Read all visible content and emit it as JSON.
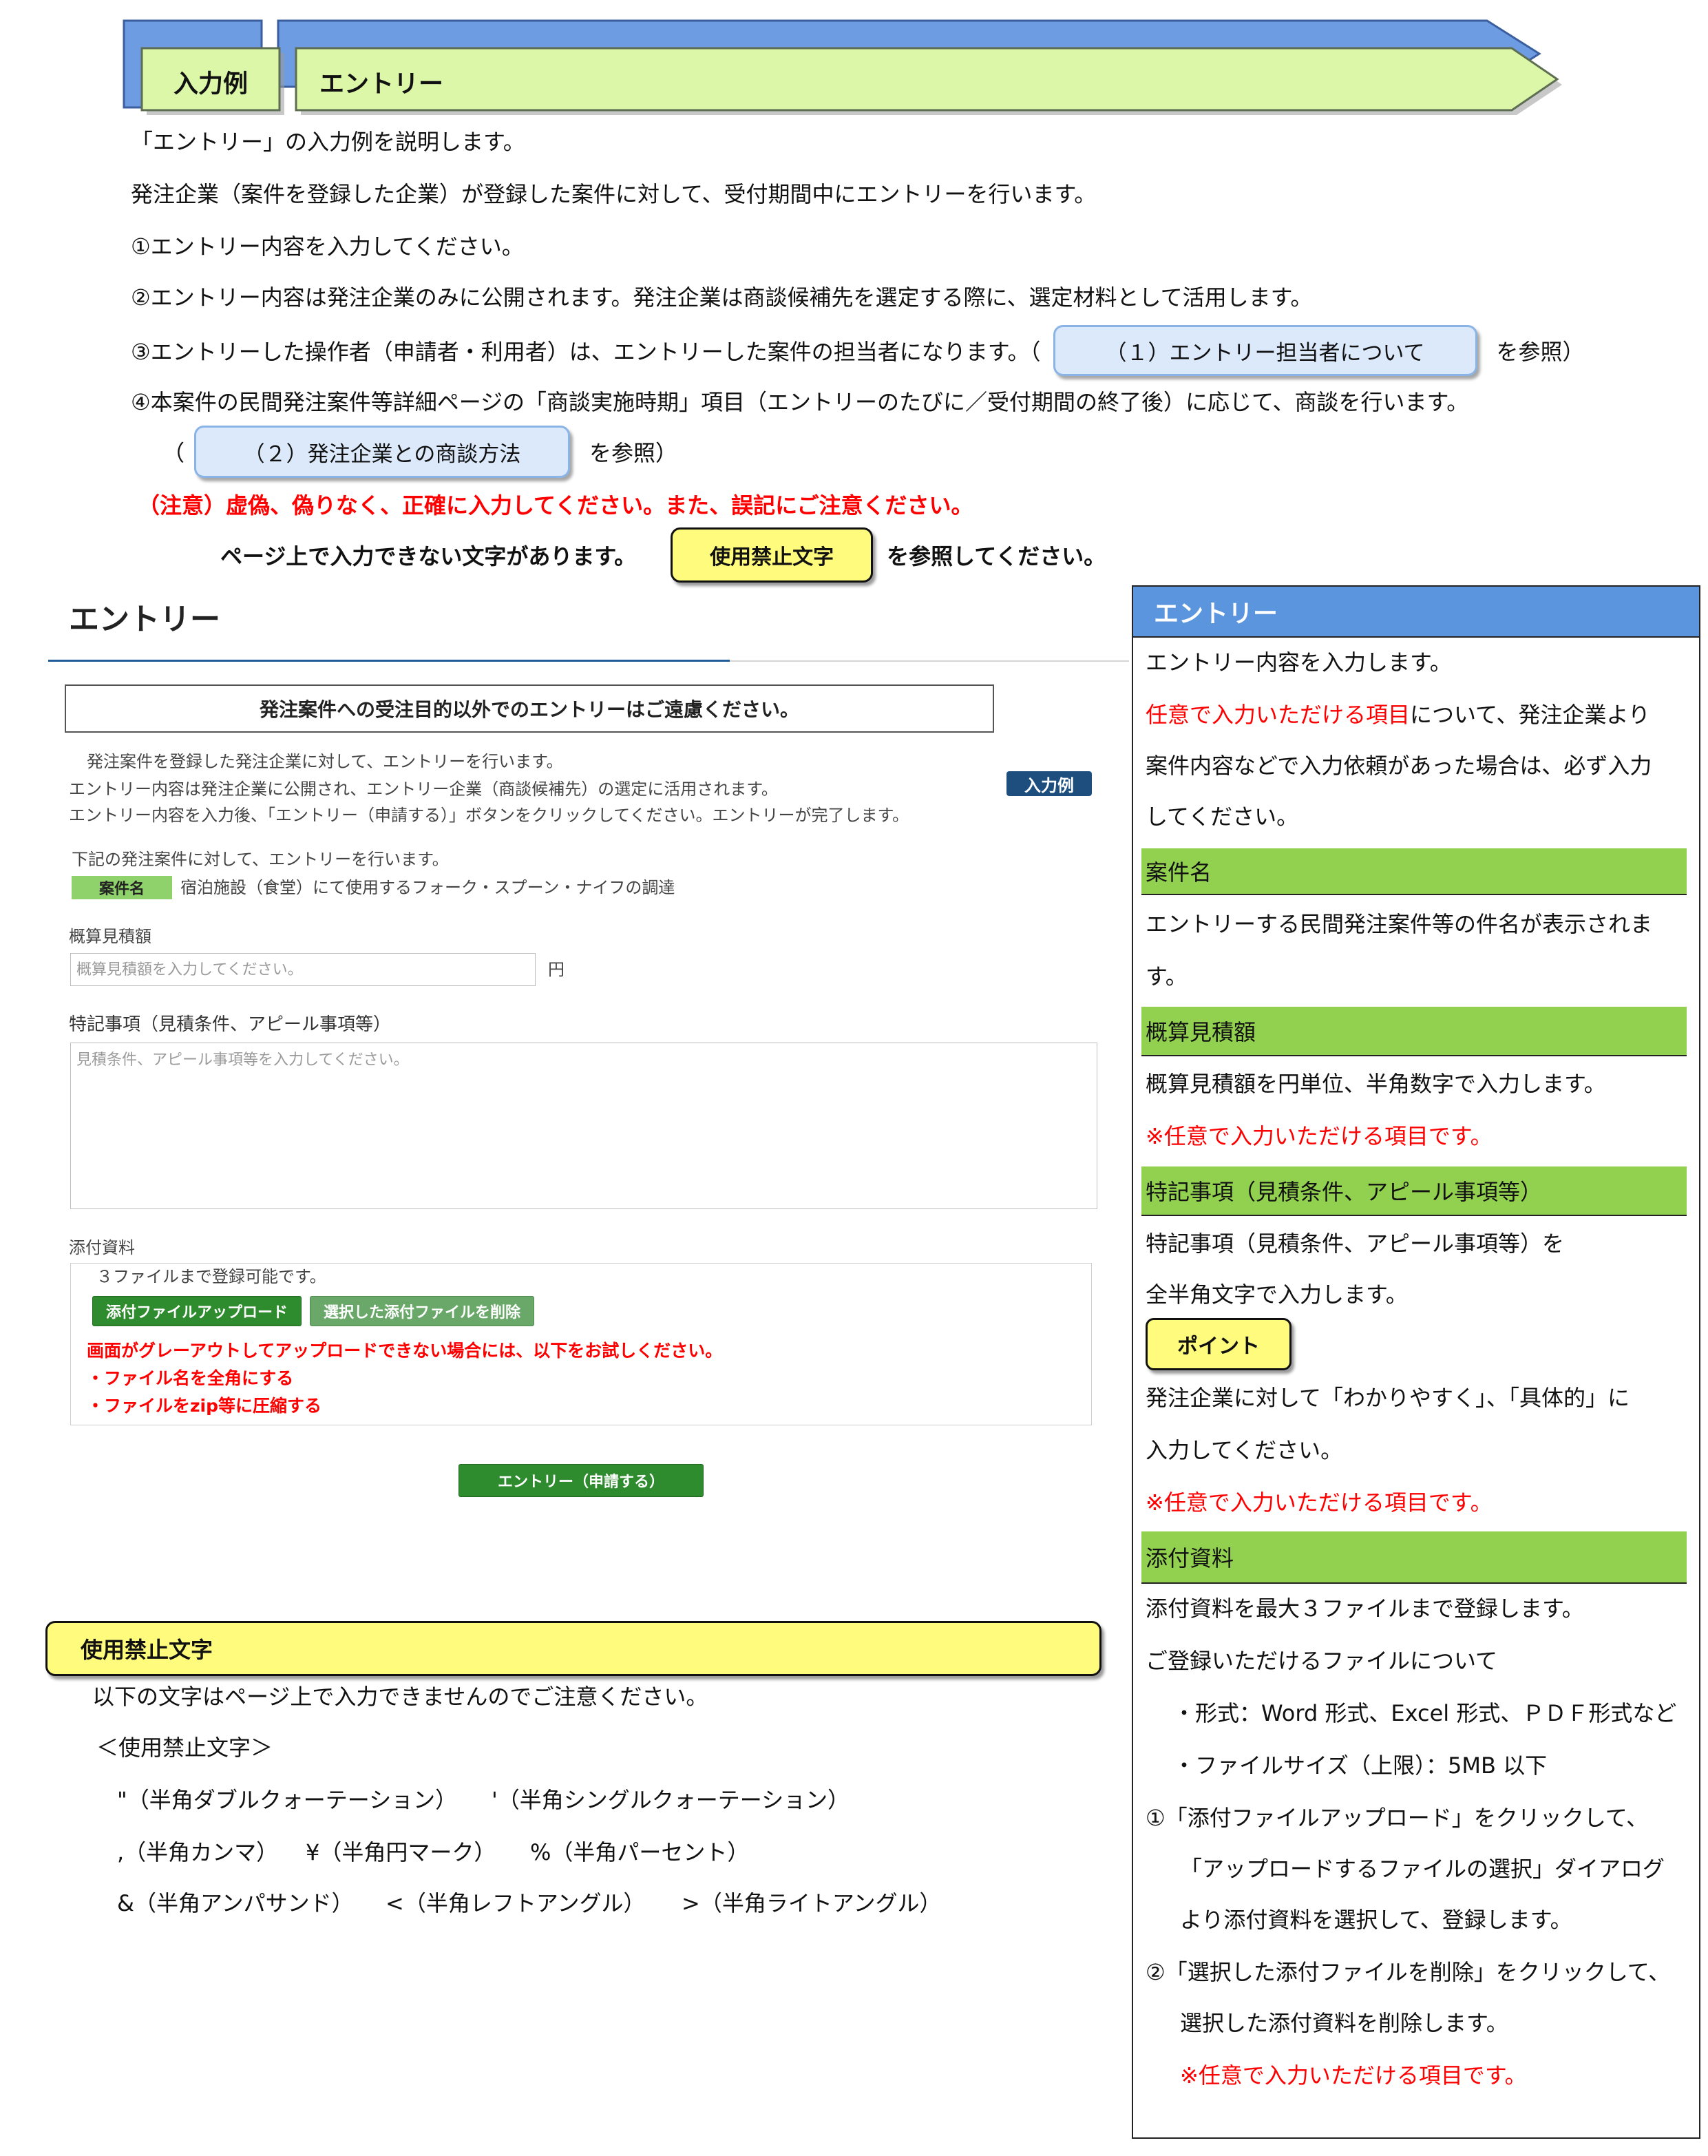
{
  "banner": {
    "tab_label": "入力例",
    "title": "エントリー"
  },
  "intro": {
    "line1": "「エントリー」の入力例を説明します。",
    "line2": "発注企業（案件を登録した企業）が登録した案件に対して、受付期間中にエントリーを行います。",
    "line3": "①エントリー内容を入力してください。",
    "line4": "②エントリー内容は発注企業のみに公開されます。発注企業は商談候補先を選定する際に、選定材料として活用します。",
    "line5_before": "③エントリーした操作者（申請者・利用者）は、エントリーした案件の担当者になります。（",
    "line5_link": "（１）エントリー担当者について",
    "line5_after": "を参照）",
    "line6": "④本案件の民間発注案件等詳細ページの「商談実施時期」項目（エントリーのたびに／受付期間の終了後）に応じて、商談を行います。",
    "line7_before": "（",
    "line7_link": "（２）発注企業との商談方法",
    "line7_after": "を参照）",
    "notice1": "（注意）虚偽、偽りなく、正確に入力してください。また、誤記にご注意ください。",
    "notice2_before": "ページ上で入力できない文字があります。",
    "notice2_link": "使用禁止文字",
    "notice2_after": "を参照してください。"
  },
  "form": {
    "heading": "エントリー",
    "warning": "発注案件への受注目的以外でのエントリーはご遠慮ください。",
    "desc1": "発注案件を登録した発注企業に対して、エントリーを行います。",
    "desc2": "エントリー内容は発注企業に公開され、エントリー企業（商談候補先）の選定に活用されます。",
    "desc3": "エントリー内容を入力後、「エントリー（申請する）」ボタンをクリックしてください。エントリーが完了します。",
    "example_badge": "入力例",
    "target_intro": "下記の発注案件に対して、エントリーを行います。",
    "case_label": "案件名",
    "case_name": "宿泊施設（食堂）にて使用するフォーク・スプーン・ナイフの調達",
    "estimate_label": "概算見積額",
    "estimate_placeholder": "概算見積額を入力してください。",
    "estimate_unit": "円",
    "notes_label": "特記事項（見積条件、アピール事項等）",
    "notes_placeholder": "見積条件、アピール事項等を入力してください。",
    "attach_label": "添付資料",
    "attach_limit": "３ファイルまで登録可能です。",
    "upload_button": "添付ファイルアップロード",
    "delete_button": "選択した添付ファイルを削除",
    "attach_warning": "画面がグレーアウトしてアップロードできない場合には、以下をお試しください。",
    "attach_tip1": "・ファイル名を全角にする",
    "attach_tip2": "・ファイルをzip等に圧縮する",
    "submit_button": "エントリー（申請する）"
  },
  "forbidden_chars": {
    "title": "使用禁止文字",
    "description": "以下の文字はページ上で入力できませんのでご注意ください。",
    "list_heading": "＜使用禁止文字＞",
    "rows": [
      [
        "\"（半角ダブルクォーテーション）",
        "'（半角シングルクォーテーション）"
      ],
      [
        ",（半角カンマ）",
        "¥（半角円マーク）",
        "%（半角パーセント）"
      ],
      [
        "&（半角アンパサンド）",
        "<（半角レフトアングル）",
        ">（半角ライトアングル）"
      ]
    ]
  },
  "guide": {
    "title": "エントリー",
    "intro_line1": "エントリー内容を入力します。",
    "intro_line2_highlight": "任意で入力いただける項目",
    "intro_line2_rest": "について、発注企業より",
    "intro_line3": "案件内容などで入力依頼があった場合は、必ず入力",
    "intro_line4": "してください。",
    "optional_note": "※任意で入力いただける項目です。",
    "case": {
      "heading": "案件名",
      "lines": [
        "エントリーする民間発注案件等の件名が表示されま",
        "す。"
      ]
    },
    "estimate": {
      "heading": "概算見積額",
      "lines": [
        "概算見積額を円単位、半角数字で入力します。"
      ]
    },
    "notes": {
      "heading": "特記事項（見積条件、アピール事項等）",
      "lines": [
        "特記事項（見積条件、アピール事項等）を",
        "全半角文字で入力します。"
      ],
      "point_label": "ポイント",
      "point_lines": [
        "発注企業に対して「わかりやすく」、「具体的」に",
        "入力してください。"
      ]
    },
    "attachments": {
      "heading": "添付資料",
      "lines": [
        "添付資料を最大３ファイルまで登録します。",
        "ご登録いただけるファイルについて",
        "・形式：Word 形式、Excel 形式、ＰＤＦ形式など",
        "・ファイルサイズ（上限）：5MB 以下",
        "①「添付ファイルアップロード」をクリックして、",
        "「アップロードするファイルの選択」ダイアログ",
        "より添付資料を選択して、登録します。",
        "②「選択した添付ファイルを削除」をクリックして、",
        "選択した添付資料を削除します。"
      ]
    }
  },
  "colors": {
    "banner_green": "#dcf7a8",
    "banner_blue": "#6e9ce3",
    "link_blue_fill": "#dbe9fb",
    "link_blue_border": "#8ab3e6",
    "notice_red": "#ff0000",
    "highlight_yellow": "#fffb7d",
    "panel_blue": "#5b95de",
    "section_green": "#92d050",
    "label_green": "#8fd16a",
    "form_green": "#2e8b2e",
    "badge_navy": "#1d4e7e"
  }
}
